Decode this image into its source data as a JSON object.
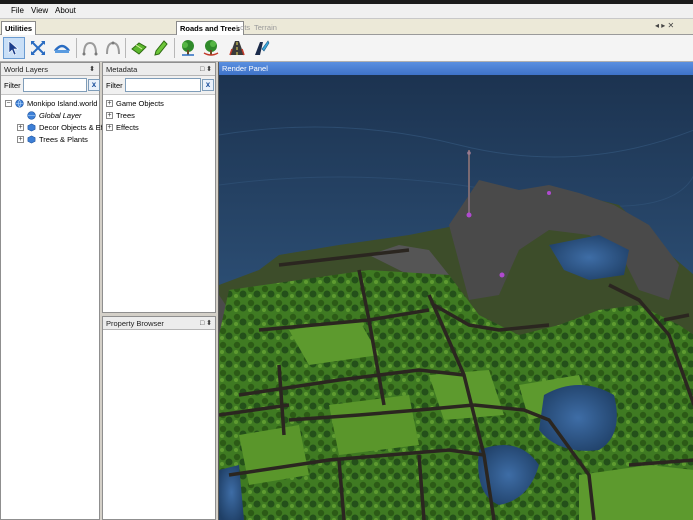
{
  "menu": {
    "items": [
      "File",
      "View",
      "About"
    ]
  },
  "tabs": {
    "left": [
      "Utilities"
    ],
    "right": [
      "Roads and Trees",
      "Lots",
      "Terrain"
    ],
    "controls": "◂ ▸ ✕"
  },
  "toolbar": {
    "buttons": [
      "select-arrow",
      "move-transform",
      "rotate-bridge",
      "arc-tool",
      "arc-tool-alt",
      "green-block",
      "pencil-tree",
      "tree-paint",
      "tree-paint-refresh",
      "road-tool",
      "road-paint"
    ]
  },
  "world_layers": {
    "title": "World Layers",
    "pin": "⬍",
    "filter_label": "Filter",
    "filter_value": "",
    "clear": "x",
    "tree": [
      {
        "label": "Monkipo Island.world",
        "expander": "−",
        "italic": false
      },
      {
        "label": "Global Layer",
        "expander": "",
        "italic": true
      },
      {
        "label": "Decor Objects & Eff",
        "expander": "+",
        "italic": false
      },
      {
        "label": "Trees & Plants",
        "expander": "+",
        "italic": false
      }
    ]
  },
  "metadata": {
    "title": "Metadata",
    "controls": "□ ⬍",
    "filter_label": "Filter",
    "filter_value": "",
    "clear": "x",
    "tree": [
      {
        "label": "Game Objects",
        "expander": "+"
      },
      {
        "label": "Trees",
        "expander": "+"
      },
      {
        "label": "Effects",
        "expander": "+"
      }
    ]
  },
  "property_browser": {
    "title": "Property Browser",
    "controls": "□ ⬍"
  },
  "render_panel": {
    "title": "Render Panel"
  },
  "colors": {
    "water": "#2a4a6e",
    "grass": "#4f8a2a",
    "road": "#2e2a22",
    "rock": "#4b4b4b"
  }
}
